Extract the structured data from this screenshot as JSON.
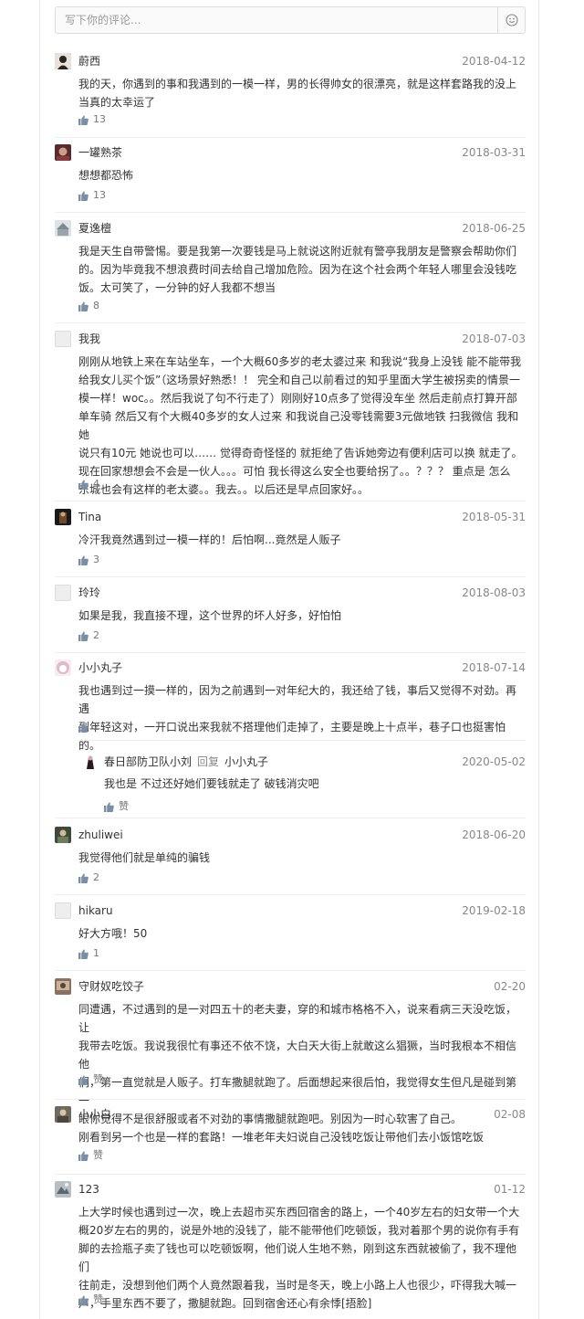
{
  "input": {
    "placeholder": "写下你的评论..."
  },
  "emoji_icon": "smiley-icon",
  "accent": "#7a8fa6",
  "comments": [
    {
      "name": "蔚西",
      "date": "2018-04-12",
      "text": "我的天，你遇到的事和我遇到的一模一样，男的长得帅女的很漂亮，就是这样套路我的⁡没上\n当真的太幸运了",
      "likes": "13"
    },
    {
      "name": "一罐熟茶",
      "date": "2018-03-31",
      "text": "想想都恐怖",
      "likes": "13"
    },
    {
      "name": "夏逸檀",
      "date": "2018-06-25",
      "text": "我是天生自带警惕。要是我第一次要钱是马上就说这附近就有警亭我朋友是警察会帮助你们\n的。因为毕竟我不想浪费时间去给自己增加危险。因为在这个社会两个年轻人哪里会没钱吃\n饭。太可笑了，一分钟的好人我都不想当",
      "likes": "8"
    },
    {
      "name": "我我",
      "date": "2018-07-03",
      "text": "刚刚从地铁上来在车站坐车，一个大概60多岁的老太婆过来 和我说“我身上没钱 能不能带我\n给我女儿买个饭”（这场景好熟悉！！ 完全和自己以前看过的知乎里面大学生被拐卖的情景一\n模一样！woc。。然后我说了句不行走了）刚刚好10点多了觉得没车坐 然后走前点打算开部\n单车骑 然后又有个大概40多岁的女人过来 和我说自己没零钱需要3元做地铁 扫我微信 我和她\n说只有10元 她说也可以…… 觉得奇奇怪怪的 就拒绝了告诉她旁边有便利店可以换 就走了。\n现在回家想想会不会是一伙人。。。可怕 我长得这么安全也要给拐了。。？？？ 重点是 怎么\n东城也会有这样的老太婆。。我去。。以后还是早点回家好。。",
      "likes": "4"
    },
    {
      "name": "Tina",
      "date": "2018-05-31",
      "text": "冷汗⁡我竟然遇到过一模一样的！后怕啊...竟然是人贩子",
      "likes": "3"
    },
    {
      "name": "玲玲",
      "date": "2018-08-03",
      "text": "如果是我，我直接不理，这个世界的坏人好多，好怕怕",
      "likes": "2"
    },
    {
      "name": "小小丸子",
      "date": "2018-07-14",
      "text": "我也遇到过一摸一样的，因为之前遇到一对年纪大的，我还给了钱，事后又觉得不对劲。再遇\n到年轻这对，一开口说出来我就不搭理他们走掉了，主要是晚上十点半，巷子口也挺害怕的。",
      "likes": "2",
      "reply": {
        "name": "春日部防卫队小刘",
        "reply_label": "回复",
        "reply_to": "小小丸子",
        "date": "2020-05-02",
        "text": "我也是 不过还好她们要钱就走了 破钱消灾吧",
        "likes": "赞"
      }
    },
    {
      "name": "zhuliwei",
      "date": "2018-06-20",
      "text": "我觉得他们就是单纯的骗钱",
      "likes": "2"
    },
    {
      "name": "hikaru",
      "date": "2019-02-18",
      "text": "好大方哦！50",
      "likes": "1"
    },
    {
      "name": "守财奴吃饺子",
      "date": "02-20",
      "text": "同遭遇，不过遇到的是一对四五十的老夫妻，穿的和城市格格不入，说来看病三天没吃饭，让\n我带去吃饭。我说我很忙有事还不依不饶，大白天大街上就敢这么猖獗，当时我根本不相信他\n们，第一直觉就是人贩子。打车撒腿就跑了。后面想起来很后怕，我觉得女生但凡是碰到第一\n眼你觉得不是很舒服或者不对劲的事情撒腿就跑吧。别因为一时心软害了自己。",
      "likes": "赞"
    },
    {
      "name": "小小白",
      "date": "02-08",
      "text": "刚看到另一个也是一样的套路！一堆老年夫妇说自己没钱吃饭让带他们去小饭馆吃饭",
      "likes": "赞"
    },
    {
      "name": "123",
      "date": "01-12",
      "text": "上大学时候也遇到过一次，晚上去超市买东西回宿舍的路上，一个40岁左右的妇女带一个大\n概20岁左右的男的，说是外地的没钱了，能不能带他们吃顿饭，我对着那个男的说你有手有\n脚的去捡瓶子卖了钱也可以吃顿饭啊，他们说人生地不熟，刚到这东西就被偷了，我不理他们\n往前走，没想到他们两个人竟然跟着我，当时是冬天，晚上小路上人也很少，吓得我大喊一\n声，手里东西不要了，撒腿就跑。回到宿舍还心有余悸[捂脸]",
      "likes": "赞"
    }
  ]
}
